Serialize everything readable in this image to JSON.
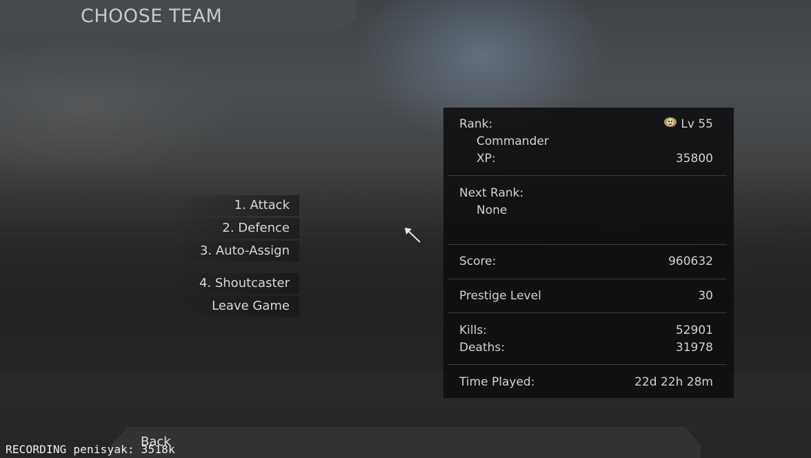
{
  "header": {
    "title": "CHOOSE TEAM"
  },
  "menu": {
    "items": [
      {
        "label": "1. Attack"
      },
      {
        "label": "2. Defence"
      },
      {
        "label": "3. Auto-Assign"
      },
      {
        "label": "4. Shoutcaster"
      },
      {
        "label": "Leave Game"
      }
    ]
  },
  "stats": {
    "rank_label": "Rank:",
    "rank_level": "Lv 55",
    "rank_name": "Commander",
    "xp_label": "XP:",
    "xp_value": "35800",
    "next_rank_label": "Next Rank:",
    "next_rank_value": "None",
    "score_label": "Score:",
    "score_value": "960632",
    "prestige_label": "Prestige Level",
    "prestige_value": "30",
    "kills_label": "Kills:",
    "kills_value": "52901",
    "deaths_label": "Deaths:",
    "deaths_value": "31978",
    "time_label": "Time Played:",
    "time_value": "22d 22h 28m",
    "rank_badge_icon": "skull-rank-badge-icon"
  },
  "footer": {
    "back_label": "Back"
  },
  "recording": {
    "text": "RECORDING penisyak: 3518k"
  },
  "colors": {
    "panel": "#0e0e0f",
    "text": "#d2d2d2",
    "header_bar": "#474a4c"
  }
}
